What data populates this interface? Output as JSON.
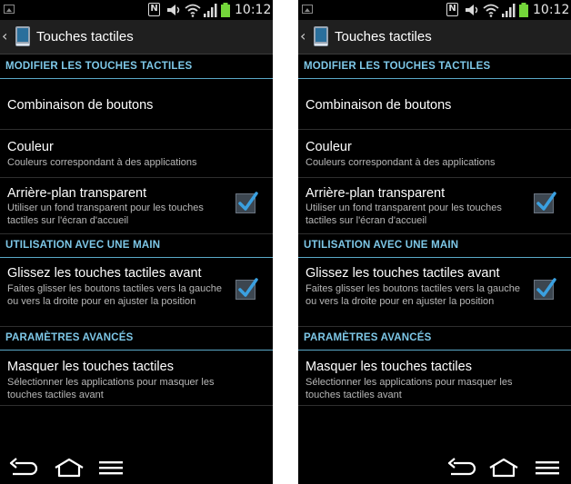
{
  "screens": [
    {
      "status": {
        "time": "10:12"
      },
      "title": "Touches tactiles",
      "sections": [
        {
          "header": "MODIFIER LES TOUCHES TACTILES"
        },
        {
          "header": "UTILISATION AVEC UNE MAIN"
        },
        {
          "header": "PARAMÈTRES AVANCÉS"
        }
      ],
      "items": [
        {
          "title": "Combinaison de boutons"
        },
        {
          "title": "Couleur",
          "summary": "Couleurs correspondant à des applications"
        },
        {
          "title": "Arrière-plan transparent",
          "summary": "Utiliser un fond transparent pour les touches tactiles sur l'écran d'accueil",
          "checked": true
        },
        {
          "title": "Glissez les touches tactiles avant",
          "summary": "Faites glisser les boutons tactiles vers la gauche ou vers la droite pour en ajuster la position",
          "checked": true
        },
        {
          "title": "Masquer les touches tactiles",
          "summary": "Sélectionner les applications pour masquer les touches tactiles avant"
        }
      ]
    },
    {
      "status": {
        "time": "10:12"
      },
      "title": "Touches tactiles",
      "sections": [
        {
          "header": "MODIFIER LES TOUCHES TACTILES"
        },
        {
          "header": "UTILISATION AVEC UNE MAIN"
        },
        {
          "header": "PARAMÈTRES AVANCÉS"
        }
      ],
      "items": [
        {
          "title": "Combinaison de boutons"
        },
        {
          "title": "Couleur",
          "summary": "Couleurs correspondant à des applications"
        },
        {
          "title": "Arrière-plan transparent",
          "summary": "Utiliser un fond transparent pour les touches tactiles sur l'écran d'accueil",
          "checked": true
        },
        {
          "title": "Glissez les touches tactiles avant",
          "summary": "Faites glisser les boutons tactiles vers la gauche ou vers la droite pour en ajuster la position",
          "checked": true
        },
        {
          "title": "Masquer les touches tactiles",
          "summary": "Sélectionner les applications pour masquer les touches tactiles avant"
        }
      ]
    }
  ],
  "icons": {
    "status": [
      "gallery-icon",
      "nfc-icon",
      "volume-icon",
      "wifi-icon",
      "signal-icon",
      "battery-icon"
    ],
    "actionbar": [
      "back-icon",
      "app-icon"
    ],
    "nav": [
      "back-nav-icon",
      "home-nav-icon",
      "menu-nav-icon"
    ],
    "check": "checkmark-icon"
  },
  "colors": {
    "section_header": "#7ec8e8",
    "divider": "#5aa9c8",
    "check": "#3aa0e0",
    "battery": "#74d63a"
  }
}
